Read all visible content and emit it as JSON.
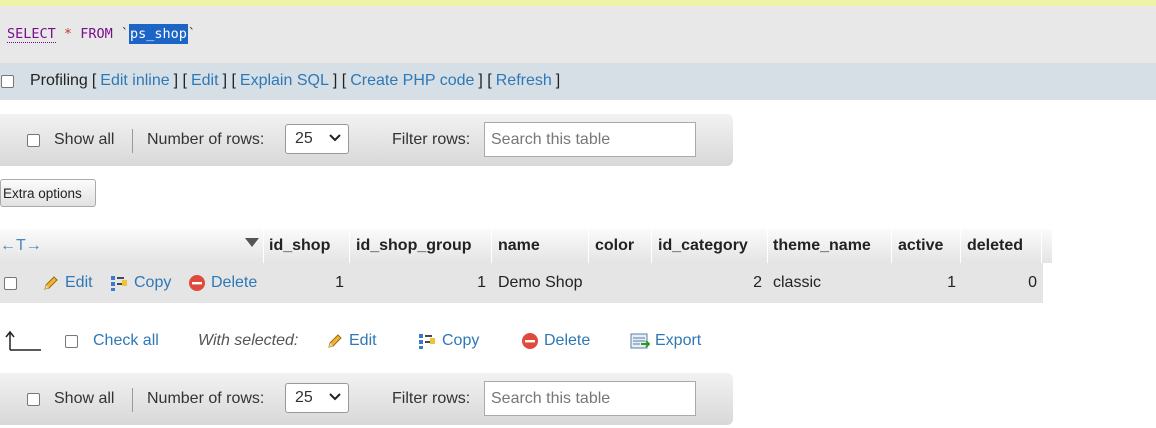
{
  "sql_query": {
    "keyword_select": "SELECT",
    "star": "*",
    "keyword_from": "FROM",
    "tick": "`",
    "table": "ps_shop"
  },
  "profiling_bar": {
    "profiling_label": "Profiling",
    "open": "[",
    "sep": "] [",
    "close": "]",
    "links": [
      "Edit inline",
      "Edit",
      "Explain SQL",
      "Create PHP code",
      "Refresh"
    ]
  },
  "nav_top": {
    "show_all": "Show all",
    "rows_label": "Number of rows:",
    "rows_value": "25",
    "filter_label": "Filter rows:",
    "search_placeholder": "Search this table"
  },
  "extra_options": "Extra options",
  "table": {
    "arrows": "←T→",
    "columns": [
      "id_shop",
      "id_shop_group",
      "name",
      "color",
      "id_category",
      "theme_name",
      "active",
      "deleted"
    ],
    "row_actions": {
      "edit": "Edit",
      "copy": "Copy",
      "delete": "Delete"
    },
    "rows": [
      {
        "id_shop": "1",
        "id_shop_group": "1",
        "name": "Demo Shop",
        "color": "",
        "id_category": "2",
        "theme_name": "classic",
        "active": "1",
        "deleted": "0"
      }
    ]
  },
  "bulk": {
    "check_all": "Check all",
    "with_selected": "With selected:",
    "edit": "Edit",
    "copy": "Copy",
    "delete": "Delete",
    "export": "Export"
  },
  "nav_bottom": {
    "show_all": "Show all",
    "rows_label": "Number of rows:",
    "rows_value": "25",
    "filter_label": "Filter rows:",
    "search_placeholder": "Search this table"
  },
  "colors": {
    "link": "#2e78b7",
    "keyword": "#7a0f8d",
    "selection": "#1c64c6",
    "delete_red": "#e04a3a"
  }
}
